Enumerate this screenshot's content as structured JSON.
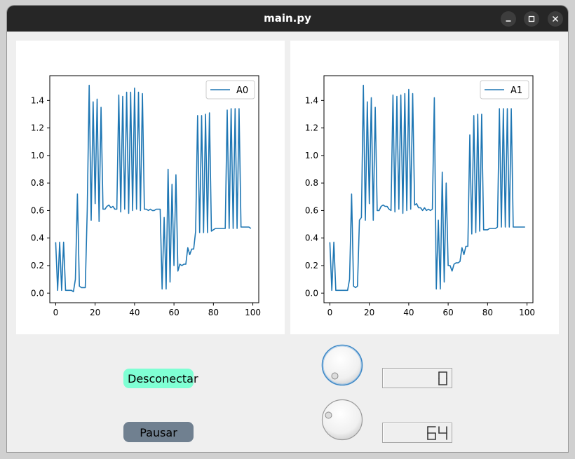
{
  "window": {
    "title": "main.py",
    "controls": {
      "minimize_icon": "minimize-icon",
      "maximize_icon": "maximize-icon",
      "close_icon": "close-icon"
    }
  },
  "buttons": {
    "connect_label": "Desconectar",
    "connect_color": "#7fffd4",
    "pause_label": "Pausar",
    "pause_color": "#708090"
  },
  "dials": [
    {
      "name": "dial-1",
      "focused": true
    },
    {
      "name": "dial-2",
      "focused": false
    }
  ],
  "lcd": [
    {
      "value": "0"
    },
    {
      "value": "64"
    }
  ],
  "chart_data": [
    {
      "type": "line",
      "x": [
        0,
        1,
        2,
        3,
        4,
        5,
        6,
        7,
        8,
        9,
        10,
        11,
        12,
        13,
        14,
        15,
        16,
        17,
        18,
        19,
        20,
        21,
        22,
        23,
        24,
        25,
        26,
        27,
        28,
        29,
        30,
        31,
        32,
        33,
        34,
        35,
        36,
        37,
        38,
        39,
        40,
        41,
        42,
        43,
        44,
        45,
        46,
        47,
        48,
        49,
        50,
        51,
        52,
        53,
        54,
        55,
        56,
        57,
        58,
        59,
        60,
        61,
        62,
        63,
        64,
        65,
        66,
        67,
        68,
        69,
        70,
        71,
        72,
        73,
        74,
        75,
        76,
        77,
        78,
        79,
        80,
        81,
        82,
        83,
        84,
        85,
        86,
        87,
        88,
        89,
        90,
        91,
        92,
        93,
        94,
        95,
        96,
        97,
        98,
        99
      ],
      "series": [
        {
          "name": "A0",
          "color": "#1f77b4",
          "values": [
            0.37,
            0.02,
            0.37,
            0.02,
            0.37,
            0.02,
            0.02,
            0.02,
            0.02,
            0.01,
            0.1,
            0.72,
            0.05,
            0.04,
            0.04,
            0.04,
            0.6,
            1.51,
            0.53,
            1.39,
            0.65,
            1.41,
            0.52,
            1.35,
            0.61,
            0.61,
            0.63,
            0.64,
            0.62,
            0.63,
            0.61,
            0.61,
            1.44,
            0.59,
            1.43,
            0.61,
            1.46,
            0.58,
            1.46,
            0.6,
            1.49,
            0.61,
            1.46,
            0.6,
            1.45,
            0.61,
            0.61,
            0.6,
            0.61,
            0.6,
            0.6,
            0.61,
            0.61,
            0.61,
            0.03,
            0.55,
            0.03,
            0.9,
            0.08,
            0.79,
            0.2,
            0.86,
            0.16,
            0.21,
            0.2,
            0.21,
            0.21,
            0.33,
            0.28,
            0.32,
            0.32,
            0.45,
            1.29,
            0.44,
            1.29,
            0.44,
            1.3,
            0.44,
            1.31,
            0.45,
            0.46,
            0.47,
            0.47,
            0.47,
            0.47,
            0.47,
            0.47,
            1.33,
            0.47,
            1.34,
            0.47,
            1.34,
            0.47,
            1.34,
            0.48,
            0.48,
            0.48,
            0.48,
            0.48,
            0.47
          ]
        }
      ],
      "legend": "top-right",
      "xlim": [
        -3,
        103
      ],
      "ylim": [
        -0.07,
        1.58
      ],
      "xticks": [
        "0",
        "20",
        "40",
        "60",
        "80",
        "100"
      ],
      "yticks": [
        "0.0",
        "0.2",
        "0.4",
        "0.6",
        "0.8",
        "1.0",
        "1.2",
        "1.4"
      ]
    },
    {
      "type": "line",
      "x": [
        0,
        1,
        2,
        3,
        4,
        5,
        6,
        7,
        8,
        9,
        10,
        11,
        12,
        13,
        14,
        15,
        16,
        17,
        18,
        19,
        20,
        21,
        22,
        23,
        24,
        25,
        26,
        27,
        28,
        29,
        30,
        31,
        32,
        33,
        34,
        35,
        36,
        37,
        38,
        39,
        40,
        41,
        42,
        43,
        44,
        45,
        46,
        47,
        48,
        49,
        50,
        51,
        52,
        53,
        54,
        55,
        56,
        57,
        58,
        59,
        60,
        61,
        62,
        63,
        64,
        65,
        66,
        67,
        68,
        69,
        70,
        71,
        72,
        73,
        74,
        75,
        76,
        77,
        78,
        79,
        80,
        81,
        82,
        83,
        84,
        85,
        86,
        87,
        88,
        89,
        90,
        91,
        92,
        93,
        94,
        95,
        96,
        97,
        98,
        99
      ],
      "series": [
        {
          "name": "A1",
          "color": "#1f77b4",
          "values": [
            0.37,
            0.02,
            0.37,
            0.02,
            0.02,
            0.02,
            0.02,
            0.02,
            0.02,
            0.02,
            0.1,
            0.72,
            0.05,
            0.04,
            0.05,
            0.53,
            0.55,
            1.51,
            0.53,
            1.39,
            0.65,
            1.42,
            0.53,
            1.35,
            0.6,
            0.6,
            0.63,
            0.64,
            0.63,
            0.63,
            0.61,
            0.6,
            1.44,
            0.59,
            1.43,
            0.61,
            1.44,
            0.58,
            1.45,
            0.6,
            1.48,
            0.61,
            1.45,
            0.64,
            0.65,
            0.62,
            0.62,
            0.6,
            0.62,
            0.6,
            0.61,
            0.6,
            0.61,
            1.42,
            0.03,
            0.53,
            0.03,
            0.88,
            0.08,
            0.8,
            0.2,
            0.2,
            0.16,
            0.21,
            0.22,
            0.22,
            0.23,
            0.33,
            0.28,
            0.34,
            0.34,
            1.15,
            0.43,
            1.29,
            0.44,
            1.3,
            0.45,
            1.3,
            0.46,
            0.46,
            0.46,
            0.47,
            0.47,
            0.47,
            0.47,
            0.48,
            1.34,
            0.48,
            1.34,
            0.48,
            1.34,
            0.48,
            1.34,
            0.48,
            0.48,
            0.48,
            0.48,
            0.48,
            0.48,
            0.48
          ]
        }
      ],
      "legend": "top-right",
      "xlim": [
        -3,
        103
      ],
      "ylim": [
        -0.07,
        1.58
      ],
      "xticks": [
        "0",
        "20",
        "40",
        "60",
        "80",
        "100"
      ],
      "yticks": [
        "0.0",
        "0.2",
        "0.4",
        "0.6",
        "0.8",
        "1.0",
        "1.2",
        "1.4"
      ]
    }
  ]
}
